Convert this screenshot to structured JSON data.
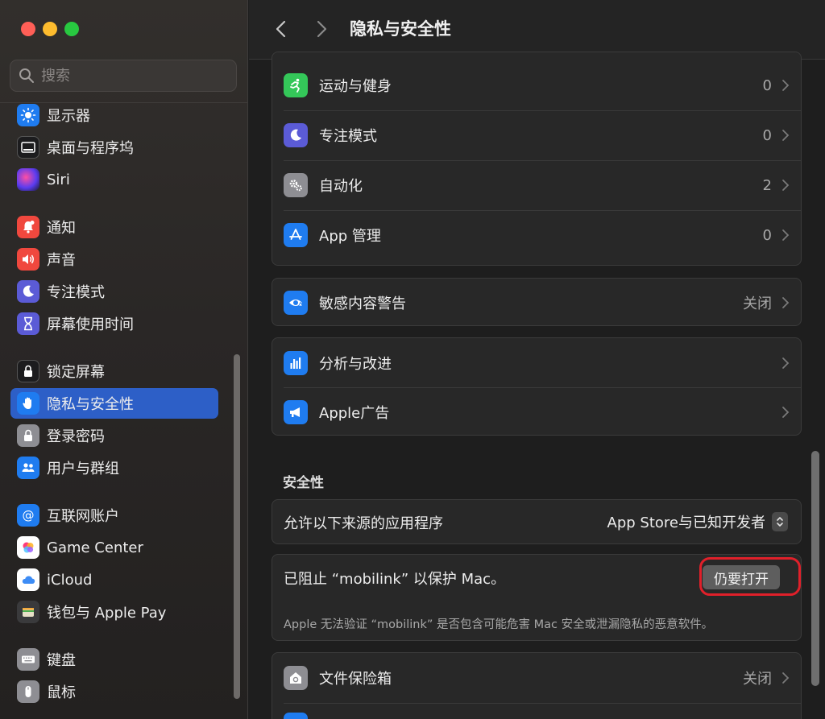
{
  "window": {
    "title": "隐私与安全性"
  },
  "sidebar": {
    "search_placeholder": "搜索",
    "items": [
      {
        "label": "显示器",
        "icon": "display-icon",
        "color": "#1f7cf0"
      },
      {
        "label": "桌面与程序坞",
        "icon": "dock-icon",
        "color": "#1c1c1e"
      },
      {
        "label": "Siri",
        "icon": "siri-icon",
        "color": "#2b2b46"
      },
      {
        "label": "通知",
        "icon": "notification-icon",
        "color": "#f0483e"
      },
      {
        "label": "声音",
        "icon": "sound-icon",
        "color": "#f0483e"
      },
      {
        "label": "专注模式",
        "icon": "moon-icon",
        "color": "#5b5bd6"
      },
      {
        "label": "屏幕使用时间",
        "icon": "hourglass-icon",
        "color": "#5b5bd6"
      },
      {
        "label": "锁定屏幕",
        "icon": "lock-screen-icon",
        "color": "#1c1c1e"
      },
      {
        "label": "隐私与安全性",
        "icon": "hand-icon",
        "color": "#1f7cf0"
      },
      {
        "label": "登录密码",
        "icon": "lock-icon",
        "color": "#8e8e93"
      },
      {
        "label": "用户与群组",
        "icon": "users-icon",
        "color": "#1f7cf0"
      },
      {
        "label": "互联网账户",
        "icon": "at-icon",
        "color": "#1f7cf0"
      },
      {
        "label": "Game Center",
        "icon": "game-center-icon",
        "color": "#ffffff"
      },
      {
        "label": "iCloud",
        "icon": "cloud-icon",
        "color": "#ffffff"
      },
      {
        "label": "钱包与 Apple Pay",
        "icon": "wallet-icon",
        "color": "#3a3a3c"
      },
      {
        "label": "键盘",
        "icon": "keyboard-icon",
        "color": "#8e8e93"
      },
      {
        "label": "鼠标",
        "icon": "mouse-icon",
        "color": "#8e8e93"
      }
    ]
  },
  "main": {
    "group1": [
      {
        "label": "运动与健身",
        "value": "0",
        "icon": "fitness-icon",
        "color": "#34c759"
      },
      {
        "label": "专注模式",
        "value": "0",
        "icon": "moon-icon",
        "color": "#5b5bd6"
      },
      {
        "label": "自动化",
        "value": "2",
        "icon": "gears-icon",
        "color": "#8e8e93"
      },
      {
        "label": "App 管理",
        "value": "0",
        "icon": "app-store-icon",
        "color": "#1f7cf0"
      }
    ],
    "sensitive": {
      "label": "敏感内容警告",
      "value": "关闭",
      "icon": "eye-warning-icon",
      "color": "#1f7cf0"
    },
    "group3": [
      {
        "label": "分析与改进",
        "icon": "chart-icon",
        "color": "#1f7cf0"
      },
      {
        "label": "Apple广告",
        "icon": "megaphone-icon",
        "color": "#1f7cf0"
      }
    ],
    "security": {
      "title": "安全性",
      "allow_label": "允许以下来源的应用程序",
      "allow_value": "App Store与已知开发者",
      "blocked_text": "已阻止 “mobilink” 以保护 Mac。",
      "open_anyway": "仍要打开",
      "blocked_desc": "Apple 无法验证 “mobilink” 是否包含可能危害 Mac 安全或泄漏隐私的恶意软件。"
    },
    "filevault": {
      "label": "文件保险箱",
      "value": "关闭",
      "icon": "vault-icon",
      "color": "#8e8e93"
    }
  },
  "colors": {
    "accent": "#2d5fc7",
    "highlight": "#e0202a"
  }
}
